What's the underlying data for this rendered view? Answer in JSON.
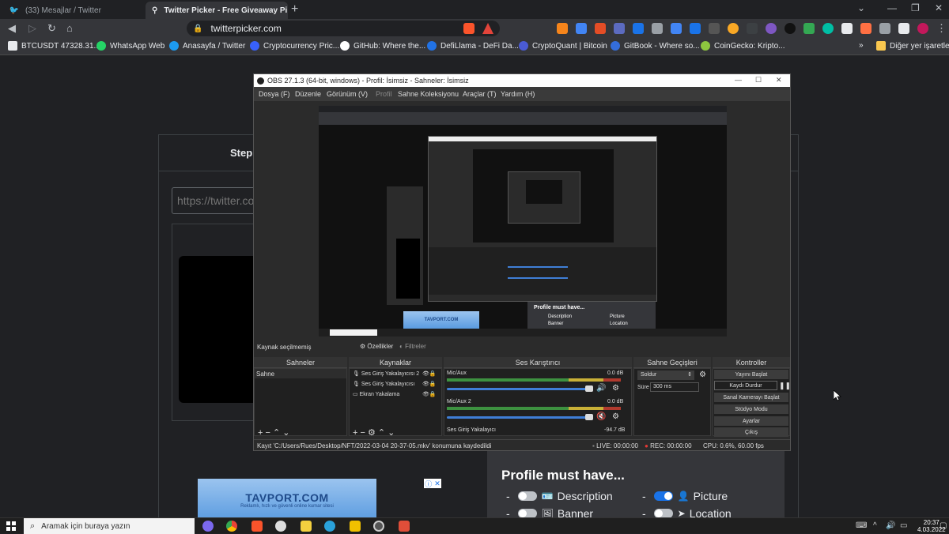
{
  "browser": {
    "tabs": [
      {
        "title": "(33) Mesajlar / Twitter",
        "active": false
      },
      {
        "title": "Twitter Picker - Free Giveaway Pi",
        "active": true
      }
    ],
    "window_controls": {
      "minimize": "—",
      "maximize": "❐",
      "close": "✕",
      "collapse": "⌄"
    },
    "address": "twitterpicker.com",
    "bookmarks": [
      {
        "label": "BTCUSDT 47328.31...",
        "color": "#e8eaed"
      },
      {
        "label": "WhatsApp Web",
        "color": "#25d366"
      },
      {
        "label": "Anasayfa / Twitter",
        "color": "#1d9bf0"
      },
      {
        "label": "Cryptocurrency Pric...",
        "color": "#3861fb"
      },
      {
        "label": "GitHub: Where the...",
        "color": "#ffffff"
      },
      {
        "label": "DefiLlama - DeFi Da...",
        "color": "#2172e5"
      },
      {
        "label": "CryptoQuant | Bitcoin",
        "color": "#4a5bd4"
      },
      {
        "label": "GitBook - Where so...",
        "color": "#346ddb"
      },
      {
        "label": "CoinGecko: Kripto...",
        "color": "#8dc63f"
      }
    ],
    "bookmarks_more": "»",
    "other_bookmarks": "Diğer yer işaretleri"
  },
  "page": {
    "step_label": "Step",
    "url_placeholder": "https://twitter.co",
    "ad": {
      "title": "TAVPORT.COM",
      "subtitle": "Reklamlı, hızlı ve güvenli online kumar sitesi",
      "close": "✕"
    },
    "profile_panel": {
      "title": "Profile must have...",
      "options": [
        {
          "label": "Description",
          "on": false,
          "icon": "id-card-icon",
          "glyph": "🪪"
        },
        {
          "label": "Picture",
          "on": true,
          "icon": "user-icon",
          "glyph": "👤"
        },
        {
          "label": "Banner",
          "on": false,
          "icon": "image-icon",
          "glyph": "🖼"
        },
        {
          "label": "Location",
          "on": false,
          "icon": "location-arrow-icon",
          "glyph": "➤"
        }
      ]
    }
  },
  "obs": {
    "title": "OBS 27.1.3 (64-bit, windows) - Profil: İsimsiz - Sahneler: İsimsiz",
    "menu": [
      "Dosya (F)",
      "Düzenle",
      "Görünüm (V)",
      "Profil",
      "Sahne Koleksiyonu",
      "Araçlar (T)",
      "Yardım (H)"
    ],
    "source_status": "Kaynak seçilmemiş",
    "properties_btn": "Özellikler",
    "filters_btn": "Filtreler",
    "docks": {
      "scenes": "Sahneler",
      "sources": "Kaynaklar",
      "mixer": "Ses Karıştırıcı",
      "transitions": "Sahne Geçişleri",
      "controls": "Kontroller"
    },
    "scenes": [
      "Sahne"
    ],
    "sources": [
      "Ses Giriş Yakalayıcısı 2",
      "Ses Giriş Yakalayıcısı",
      "Ekran Yakalama"
    ],
    "mixer": [
      {
        "name": "Mic/Aux",
        "db": "0.0 dB"
      },
      {
        "name": "Mic/Aux 2",
        "db": "0.0 dB"
      },
      {
        "name": "Ses Giriş Yakalayıcı",
        "db": "-94.7 dB"
      }
    ],
    "transition": {
      "type": "Soldur",
      "duration_label": "Süre",
      "duration": "300 ms"
    },
    "controls": [
      "Yayını Başlat",
      "Kaydı Durdur",
      "Sanal Kamerayı Başlat",
      "Stüdyo Modu",
      "Ayarlar",
      "Çıkış"
    ],
    "footer": {
      "saved": "Kayıt 'C:/Users/Rues/Desktop/NFT/2022-03-04 20-37-05.mkv' konumuna kaydedildi",
      "live": "LIVE: 00:00:00",
      "rec": "REC: 00:00:00",
      "cpu": "CPU: 0.6%, 60.00 fps"
    }
  },
  "taskbar": {
    "search_placeholder": "Aramak için buraya yazın",
    "time": "20:37",
    "date": "4.03.2022"
  }
}
